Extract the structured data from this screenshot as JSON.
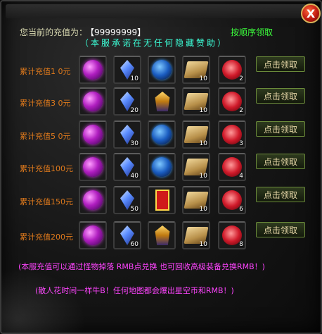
{
  "header": {
    "current_label": "您当前的充值为：",
    "current_value": "【99999999】",
    "order_link": "按顺序领取",
    "promise": "（本服承诺在无任何隐藏赞助）",
    "close_label": "X"
  },
  "rows": [
    {
      "label": "累计充值1 0元",
      "counts": [
        "",
        "10",
        "",
        "10",
        "2"
      ],
      "claim": "点击领取"
    },
    {
      "label": "累计充值3 0元",
      "counts": [
        "",
        "20",
        "",
        "10",
        "2"
      ],
      "claim": "点击领取"
    },
    {
      "label": "累计充值5 0元",
      "counts": [
        "",
        "30",
        "",
        "10",
        "3"
      ],
      "claim": "点击领取"
    },
    {
      "label": "累计充值100元",
      "counts": [
        "",
        "40",
        "",
        "10",
        "4"
      ],
      "claim": "点击领取"
    },
    {
      "label": "累计充值150元",
      "counts": [
        "",
        "50",
        "",
        "10",
        "6"
      ],
      "claim": "点击领取"
    },
    {
      "label": "累计充值200元",
      "counts": [
        "",
        "60",
        "",
        "10",
        "8"
      ],
      "claim": "点击领取"
    }
  ],
  "notes": {
    "line1": "(本服充值可以通过怪物掉落 RMB点兑换  也可回收高级装备兑换RMB！)",
    "line2": "(散人花时间一样牛B！任何地图都会爆出星空币和RMB！)"
  },
  "icons": {
    "row0": [
      "purple-orb-icon",
      "blue-crystal-icon",
      "blue-sphere-icon",
      "gold-scroll-icon",
      "red-gem-icon"
    ],
    "row1": [
      "purple-orb-icon",
      "blue-crystal-icon",
      "gold-helmet-icon",
      "gold-scroll-icon",
      "red-gem-icon"
    ],
    "row2": [
      "purple-orb-icon",
      "blue-crystal-icon",
      "blue-sphere-icon",
      "gold-scroll-icon",
      "red-gem-icon"
    ],
    "row3": [
      "purple-orb-icon",
      "blue-crystal-icon",
      "blue-sphere-icon",
      "gold-scroll-icon",
      "red-gem-icon"
    ],
    "row4": [
      "purple-orb-icon",
      "blue-crystal-icon",
      "red-card-icon",
      "gold-scroll-icon",
      "red-gem-icon"
    ],
    "row5": [
      "purple-orb-icon",
      "blue-crystal-icon",
      "gold-helmet-icon",
      "gold-scroll-icon",
      "red-gem-icon"
    ]
  },
  "colors": {
    "title_text": "#d8d8b0",
    "order_link": "#3cff3c",
    "promise": "#3cffd8",
    "row_label": "#e07a1c",
    "notes": "#ff44ff"
  }
}
